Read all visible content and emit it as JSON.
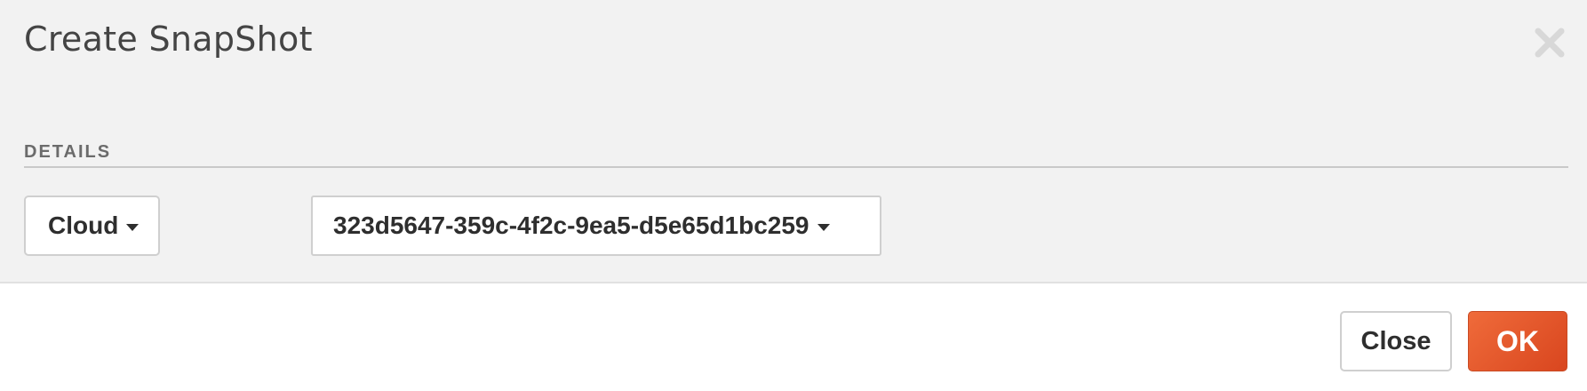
{
  "dialog": {
    "title": "Create SnapShot",
    "close_icon": "close-icon"
  },
  "details": {
    "section_label": "DETAILS",
    "cloud_dropdown": {
      "selected": "Cloud"
    },
    "instance_dropdown": {
      "selected": "323d5647-359c-4f2c-9ea5-d5e65d1bc259"
    }
  },
  "footer": {
    "close_label": "Close",
    "ok_label": "OK"
  },
  "colors": {
    "body_bg": "#f2f2f2",
    "accent": "#e5572b"
  }
}
